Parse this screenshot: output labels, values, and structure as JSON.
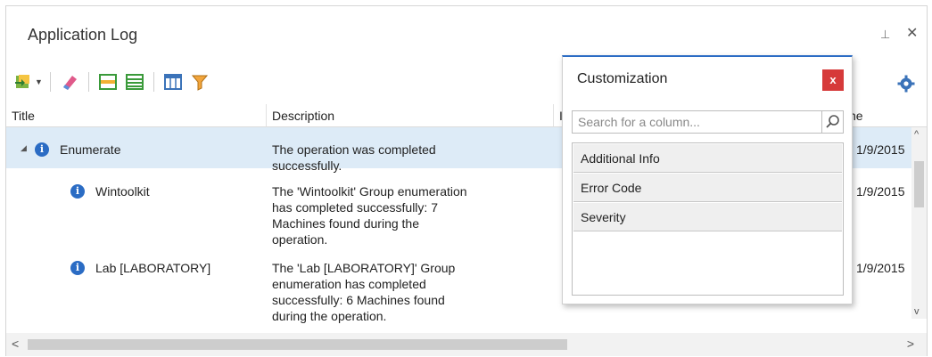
{
  "panel": {
    "title": "Application Log",
    "pin_glyph": "⊥",
    "close_glyph": "✕"
  },
  "toolbar": {
    "icons": [
      "import-icon",
      "eraser-icon",
      "rows-icon",
      "list-icon",
      "grid-icon",
      "filter-icon",
      "gear-icon"
    ]
  },
  "grid": {
    "columns": [
      "Title",
      "Description",
      "I",
      "ime"
    ],
    "rows": [
      {
        "title": "Enumerate",
        "description": [
          "The operation was completed",
          "successfully."
        ],
        "time": "1/9/2015"
      },
      {
        "title": "Wintoolkit",
        "description": [
          "The 'Wintoolkit' Group enumeration",
          "has completed successfully: 7",
          "Machines found during the",
          "operation."
        ],
        "time": "1/9/2015"
      },
      {
        "title": "Lab [LABORATORY]",
        "description": [
          "The 'Lab [LABORATORY]' Group",
          "enumeration has completed",
          "successfully: 6 Machines found",
          "during the operation."
        ],
        "time": "1/9/2015"
      }
    ]
  },
  "customization": {
    "title": "Customization",
    "close_glyph": "x",
    "search_placeholder": "Search for a column...",
    "columns": [
      "Additional Info",
      "Error Code",
      "Severity"
    ]
  },
  "colors": {
    "accent": "#2b6cc4",
    "highlight": "#ddebf7",
    "close_red": "#d63a3a"
  }
}
